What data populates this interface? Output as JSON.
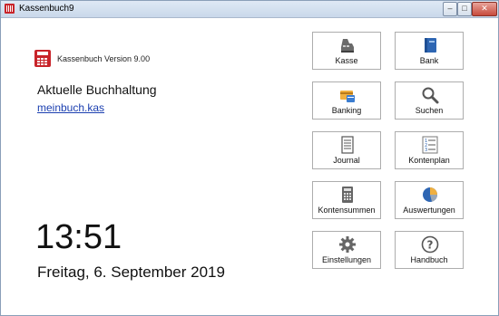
{
  "window": {
    "title": "Kassenbuch9",
    "minimize_glyph": "–",
    "maximize_glyph": "□",
    "close_glyph": "✕"
  },
  "header": {
    "version": "Kassenbuch Version 9.00",
    "icon": "calculator-icon"
  },
  "book": {
    "title": "Aktuelle Buchhaltung",
    "file": "meinbuch.kas"
  },
  "clock": {
    "time": "13:51",
    "date": "Freitag, 6. September 2019"
  },
  "tiles": [
    {
      "label": "Kasse",
      "icon": "cash-register-icon"
    },
    {
      "label": "Bank",
      "icon": "bank-book-icon"
    },
    {
      "label": "Banking",
      "icon": "banking-card-icon"
    },
    {
      "label": "Suchen",
      "icon": "magnifier-icon"
    },
    {
      "label": "Journal",
      "icon": "journal-icon"
    },
    {
      "label": "Kontenplan",
      "icon": "numbered-list-icon"
    },
    {
      "label": "Kontensummen",
      "icon": "calculator-icon"
    },
    {
      "label": "Auswertungen",
      "icon": "pie-chart-icon"
    },
    {
      "label": "Einstellungen",
      "icon": "gear-icon"
    },
    {
      "label": "Handbuch",
      "icon": "help-icon"
    }
  ],
  "colors": {
    "brand_red": "#c8242a",
    "link": "#1b3fb0",
    "tile_border": "#adadad"
  }
}
